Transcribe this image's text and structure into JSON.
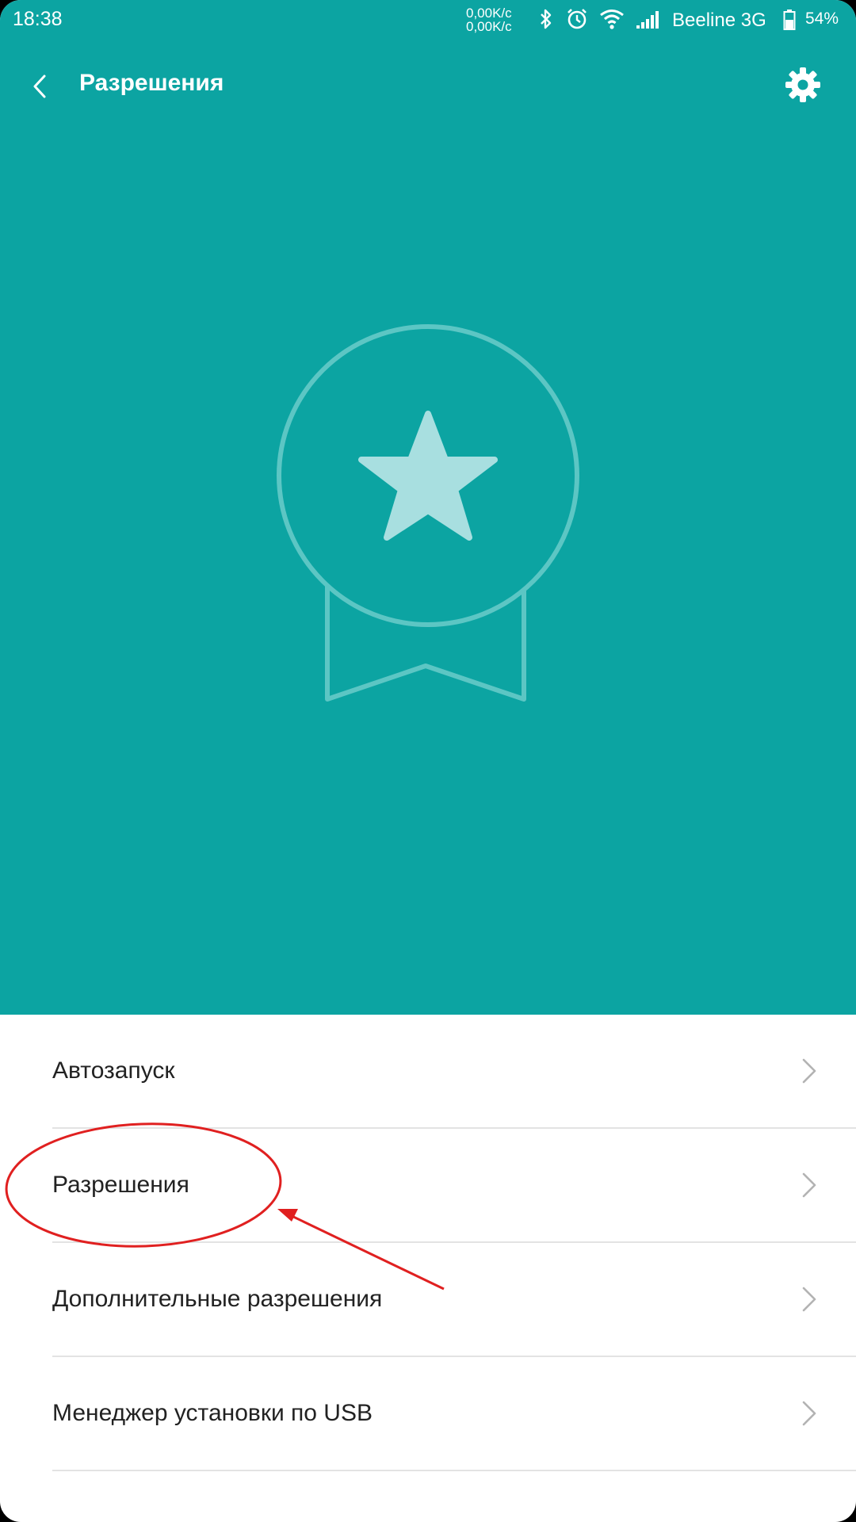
{
  "status_bar": {
    "time": "18:38",
    "net_speed_up": "0,00K/c",
    "net_speed_down": "0,00K/c",
    "carrier": "Beeline 3G",
    "battery": "54%",
    "icons": [
      "bluetooth-icon",
      "alarm-icon",
      "wifi-icon",
      "signal-icon",
      "battery-icon"
    ]
  },
  "toolbar": {
    "title": "Разрешения",
    "back_icon": "chevron-left-icon",
    "settings_icon": "gear-icon"
  },
  "hero": {
    "illustration": "medal-star-icon",
    "background_color": "#0ca4a2"
  },
  "menu": {
    "items": [
      {
        "label": "Автозапуск"
      },
      {
        "label": "Разрешения"
      },
      {
        "label": "Дополнительные разрешения"
      },
      {
        "label": "Менеджер установки по USB"
      }
    ]
  },
  "annotation": {
    "highlight_color": "#e02020",
    "highlighted_item": "Разрешения"
  }
}
